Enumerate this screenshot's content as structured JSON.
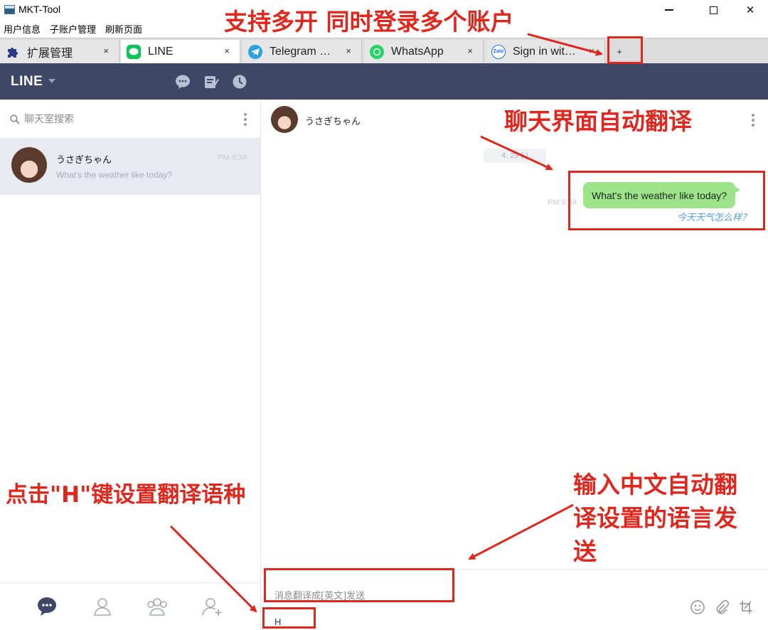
{
  "window": {
    "title": "MKT-Tool",
    "minimize": "—",
    "maximize": "□",
    "close": "✕"
  },
  "menu": [
    "用户信息",
    "子账户管理",
    "刷新页面"
  ],
  "tabs": [
    {
      "label": "扩展管理",
      "icon": "puzzle-icon",
      "close": "×",
      "active": false
    },
    {
      "label": "LINE",
      "icon": "line-icon",
      "close": "×",
      "active": true
    },
    {
      "label": "Telegram …",
      "icon": "telegram-icon",
      "close": "×",
      "active": false
    },
    {
      "label": "WhatsApp",
      "icon": "whatsapp-icon",
      "close": "×",
      "active": false
    },
    {
      "label": "Sign in wit…",
      "icon": "zalo-icon",
      "close": "×",
      "active": false
    }
  ],
  "new_tab_label": "+",
  "line": {
    "logo": "LINE",
    "search_placeholder": "聊天室搜索",
    "chats": [
      {
        "name": "うさぎちゃん",
        "preview": "What's the weather like today?",
        "time": "PM 9:34"
      }
    ]
  },
  "conversation": {
    "contact_name": "うさぎちゃん",
    "date": "4. 29 (    )",
    "messages": [
      {
        "text": "What's the weather like today?",
        "time": "PM 9:34",
        "translation": "今天天气怎么样？",
        "outgoing": true
      }
    ],
    "input_placeholder": "消息翻译成[英文]发送",
    "hotkey": "H"
  },
  "annotations": {
    "multi_open": "支持多开 同时登录多个账户",
    "auto_translate": "聊天界面自动翻译",
    "hotkey": "点击\"H\"键设置翻译语种",
    "input_translate": [
      "输入中文自动翻",
      "译设置的语言发",
      "送"
    ]
  },
  "colors": {
    "header_bg": "#3e4866",
    "selected_chat_bg": "#e8eaf1",
    "bubble_green": "#9ee48a",
    "translation_blue": "#4fa0d8",
    "annotation_red": "#e0271e"
  }
}
